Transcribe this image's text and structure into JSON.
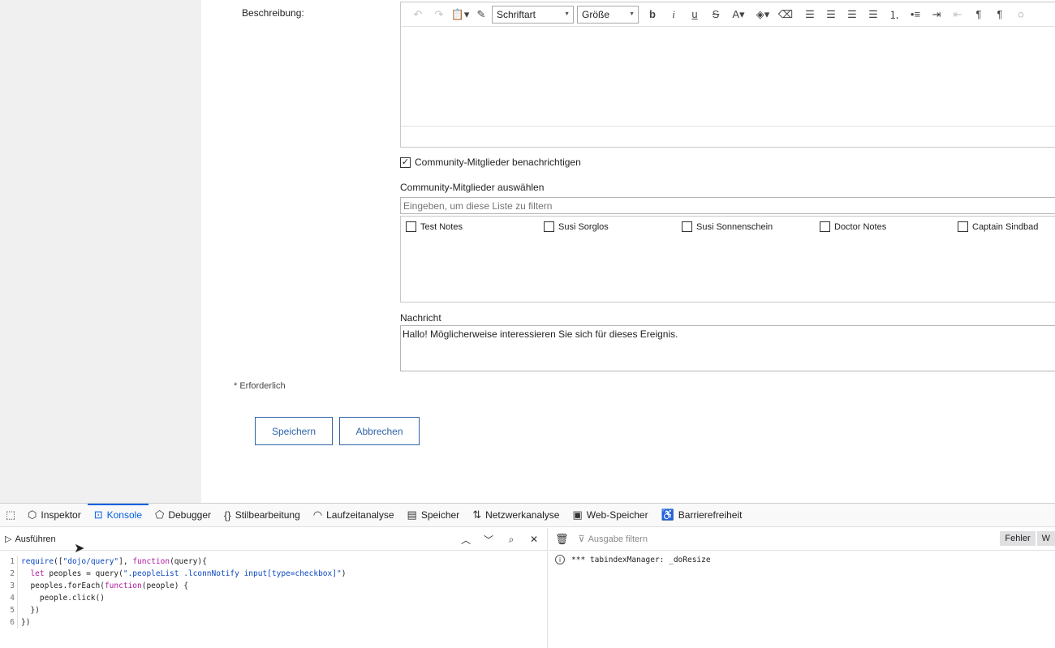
{
  "form": {
    "description_label": "Beschreibung:",
    "toolbar": {
      "font_select": "Schriftart",
      "size_select": "Größe"
    },
    "notify_label": "Community-Mitglieder benachrichtigen",
    "notify_checked": true,
    "select_members_label": "Community-Mitglieder auswählen",
    "filter_placeholder": "Eingeben, um diese Liste zu filtern",
    "members": [
      {
        "name": "Test Notes"
      },
      {
        "name": "Susi Sorglos"
      },
      {
        "name": "Susi Sonnenschein"
      },
      {
        "name": "Doctor Notes"
      },
      {
        "name": "Captain Sindbad"
      }
    ],
    "message_label": "Nachricht",
    "message_text": "Hallo! Möglicherweise interessieren Sie sich für dieses Ereignis.",
    "required_note": "* Erforderlich",
    "save_label": "Speichern",
    "cancel_label": "Abbrechen"
  },
  "devtools": {
    "tabs": [
      {
        "label": "Inspektor",
        "icon": "inspector-icon"
      },
      {
        "label": "Konsole",
        "icon": "console-icon",
        "active": true
      },
      {
        "label": "Debugger",
        "icon": "debugger-icon"
      },
      {
        "label": "Stilbearbeitung",
        "icon": "style-editor-icon"
      },
      {
        "label": "Laufzeitanalyse",
        "icon": "performance-icon"
      },
      {
        "label": "Speicher",
        "icon": "memory-icon"
      },
      {
        "label": "Netzwerkanalyse",
        "icon": "network-icon"
      },
      {
        "label": "Web-Speicher",
        "icon": "storage-icon"
      },
      {
        "label": "Barrierefreiheit",
        "icon": "accessibility-icon"
      }
    ],
    "run_label": "Ausführen",
    "filter_placeholder": "Ausgabe filtern",
    "level_errors": "Fehler",
    "level_warnings": "W",
    "code_lines": [
      {
        "n": "1",
        "parts": [
          [
            "fn",
            "require"
          ],
          [
            "plain",
            "(["
          ],
          [
            "str",
            "\"dojo/query\""
          ],
          [
            "plain",
            "], "
          ],
          [
            "kw",
            "function"
          ],
          [
            "plain",
            "(query){"
          ]
        ]
      },
      {
        "n": "2",
        "parts": [
          [
            "plain",
            "  "
          ],
          [
            "kw",
            "let"
          ],
          [
            "plain",
            " peoples = query("
          ],
          [
            "str",
            "\".peopleList .lconnNotify input[type=checkbox]\""
          ],
          [
            "plain",
            ")"
          ]
        ]
      },
      {
        "n": "3",
        "parts": [
          [
            "plain",
            "  peoples.forEach("
          ],
          [
            "kw",
            "function"
          ],
          [
            "plain",
            "(people) {"
          ]
        ]
      },
      {
        "n": "4",
        "parts": [
          [
            "plain",
            "    people.click()"
          ]
        ]
      },
      {
        "n": "5",
        "parts": [
          [
            "plain",
            "  })"
          ]
        ]
      },
      {
        "n": "6",
        "parts": [
          [
            "plain",
            "})"
          ]
        ]
      }
    ],
    "log_message": "*** tabindexManager:  _doResize"
  },
  "colors": {
    "accent": "#0060df",
    "button_border": "#2f63a8"
  }
}
